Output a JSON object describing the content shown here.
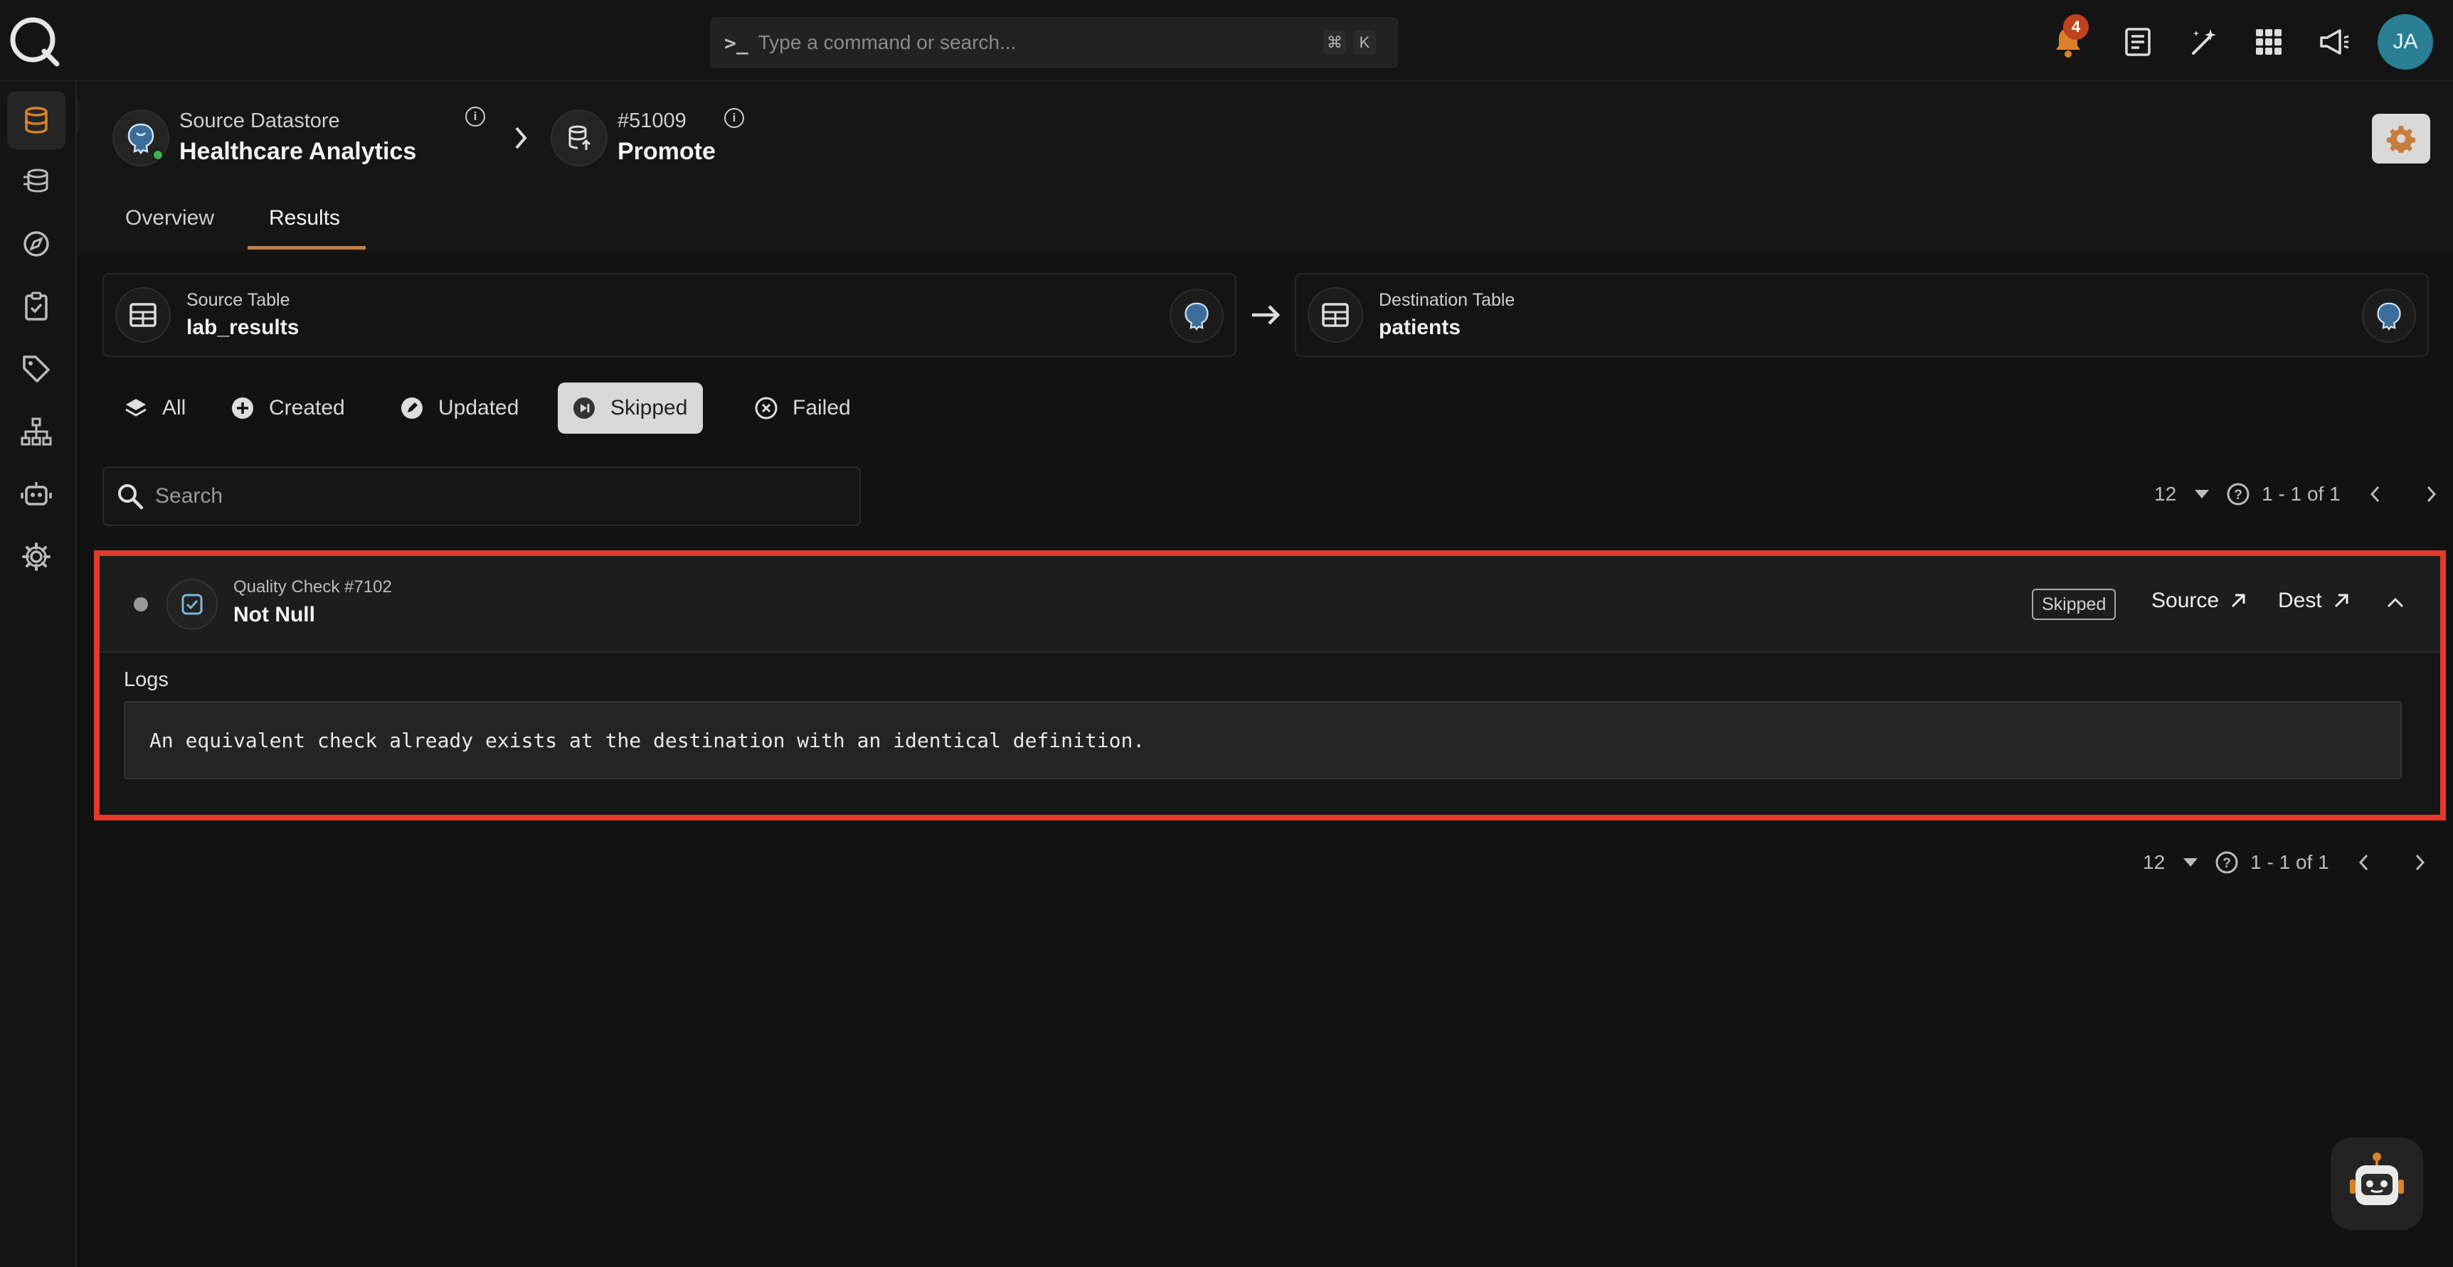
{
  "topbar": {
    "search_placeholder": "Type a command or search...",
    "shortcut_cmd": "⌘",
    "shortcut_key": "K",
    "notifications_count": "4",
    "avatar_initials": "JA"
  },
  "breadcrumb": {
    "source_label": "Source Datastore",
    "source_name": "Healthcare Analytics",
    "operation_id": "#51009",
    "operation_name": "Promote"
  },
  "tabs": [
    {
      "label": "Overview",
      "active": false
    },
    {
      "label": "Results",
      "active": true
    }
  ],
  "tables": {
    "source_label": "Source Table",
    "source_name": "lab_results",
    "dest_label": "Destination Table",
    "dest_name": "patients"
  },
  "filters": [
    {
      "label": "All",
      "icon": "layers-icon",
      "active": false
    },
    {
      "label": "Created",
      "icon": "plus-circle-icon",
      "active": false
    },
    {
      "label": "Updated",
      "icon": "pencil-circle-icon",
      "active": false
    },
    {
      "label": "Skipped",
      "icon": "skip-icon",
      "active": true
    },
    {
      "label": "Failed",
      "icon": "x-circle-icon",
      "active": false
    }
  ],
  "search": {
    "placeholder": "Search"
  },
  "pagination": {
    "page_size": "12",
    "range": "1 - 1 of 1"
  },
  "result": {
    "check_label": "Quality Check #7102",
    "check_name": "Not Null",
    "status": "Skipped",
    "source_link": "Source",
    "dest_link": "Dest",
    "logs_label": "Logs",
    "log_text": "An equivalent check already exists at the destination with an identical definition."
  },
  "colors": {
    "accent": "#c77d3f",
    "highlight": "#e5392b",
    "avatar": "#2a7f95",
    "badge": "#c2421f"
  }
}
